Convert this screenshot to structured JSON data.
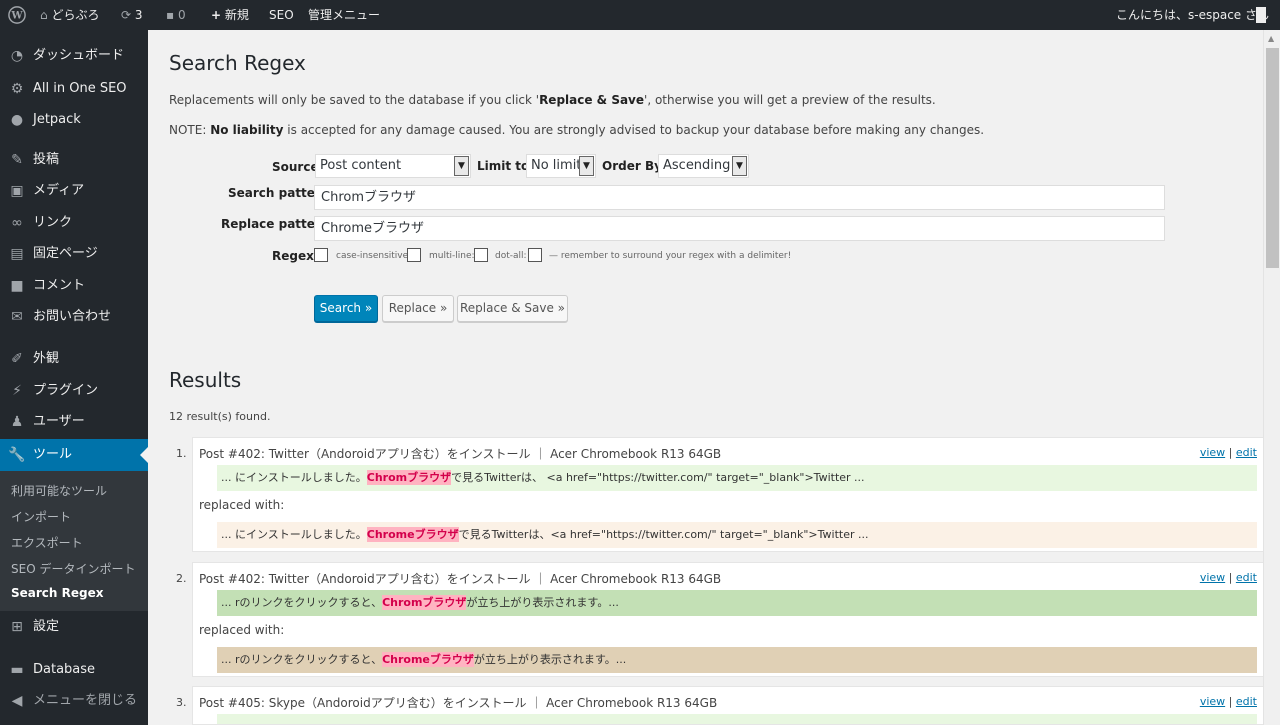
{
  "adminbar": {
    "site_name": "どらぶろ",
    "updates_count": "3",
    "comments_count": "0",
    "new_label": "新規",
    "seo_label": "SEO",
    "admin_menu_label": "管理メニュー",
    "greeting": "こんにちは、s-espace さん"
  },
  "sidebar": {
    "items": [
      {
        "label": "ダッシュボード",
        "icon": "dashboard-icon"
      },
      {
        "label": "All in One SEO",
        "icon": "gear-icon"
      },
      {
        "label": "Jetpack",
        "icon": "jetpack-icon"
      },
      {
        "label": "投稿",
        "icon": "pin-icon"
      },
      {
        "label": "メディア",
        "icon": "media-icon"
      },
      {
        "label": "リンク",
        "icon": "link-icon"
      },
      {
        "label": "固定ページ",
        "icon": "page-icon"
      },
      {
        "label": "コメント",
        "icon": "comment-icon"
      },
      {
        "label": "お問い合わせ",
        "icon": "mail-icon"
      },
      {
        "label": "外観",
        "icon": "brush-icon"
      },
      {
        "label": "プラグイン",
        "icon": "plugin-icon"
      },
      {
        "label": "ユーザー",
        "icon": "user-icon"
      },
      {
        "label": "ツール",
        "icon": "wrench-icon"
      },
      {
        "label": "設定",
        "icon": "settings-icon"
      },
      {
        "label": "Database",
        "icon": "database-icon"
      },
      {
        "label": "メニューを閉じる",
        "icon": "collapse-icon"
      }
    ],
    "submenu": [
      "利用可能なツール",
      "インポート",
      "エクスポート",
      "SEO データインポート",
      "Search Regex"
    ]
  },
  "page": {
    "title": "Search Regex",
    "note1_pre": "Replacements will only be saved to the database if you click '",
    "note1_bold": "Replace & Save",
    "note1_post": "', otherwise you will get a preview of the results.",
    "note2_pre": "NOTE: ",
    "note2_bold": "No liability",
    "note2_post": " is accepted for any damage caused. You are strongly advised to backup your database before making any changes."
  },
  "form": {
    "source_label": "Source",
    "source_value": "Post content",
    "limit_label": "Limit to:",
    "limit_value": "No limit",
    "order_label": "Order By:",
    "order_value": "Ascending",
    "search_label": "Search pattern",
    "search_value": "Chromブラウザ",
    "replace_label": "Replace pattern",
    "replace_value": "Chromeブラウザ",
    "regex_label": "Regex:",
    "case_label": "case-insensitive:",
    "multiline_label": "multi-line:",
    "dotall_label": "dot-all:",
    "hint": "— remember to surround your regex with a delimiter!",
    "search_button": "Search »",
    "replace_button": "Replace »",
    "replace_save_button": "Replace & Save »"
  },
  "results": {
    "title": "Results",
    "count": "12 result(s) found.",
    "replaced_with": "replaced with:",
    "view": "view",
    "edit": "edit",
    "separator": "|",
    "items": [
      {
        "num": "1.",
        "title": "Post #402: Twitter（Andoroidアプリ含む）をインストール ｜ Acer Chromebook R13 64GB",
        "before_pre": "... にインストールしました。",
        "before_hl": "Chromブラウザ",
        "before_post": "で見るTwitterは、 <a href=\"https://twitter.com/\" target=\"_blank\">Twitter ...",
        "after_pre": "... にインストールしました。",
        "after_hl": "Chromeブラウザ",
        "after_post": "で見るTwitterは、<a href=\"https://twitter.com/\" target=\"_blank\">Twitter ..."
      },
      {
        "num": "2.",
        "title": "Post #402: Twitter（Andoroidアプリ含む）をインストール ｜ Acer Chromebook R13 64GB",
        "before_pre": "... rのリンクをクリックすると、",
        "before_hl": "Chromブラウザ",
        "before_post": "が立ち上がり表示されます。...",
        "after_pre": "... rのリンクをクリックすると、",
        "after_hl": "Chromeブラウザ",
        "after_post": "が立ち上がり表示されます。..."
      },
      {
        "num": "3.",
        "title": "Post #405: Skype（Andoroidアプリ含む）をインストール ｜ Acer Chromebook R13 64GB"
      }
    ]
  },
  "colors": {
    "admin_bg": "#23282d",
    "accent": "#0073aa",
    "before_bg_1": "#e8f7e0",
    "after_bg_1": "#fbf1e6",
    "before_bg_2": "#c3e0b5",
    "after_bg_2": "#e0d0b5",
    "highlight_text": "#d3004b"
  }
}
